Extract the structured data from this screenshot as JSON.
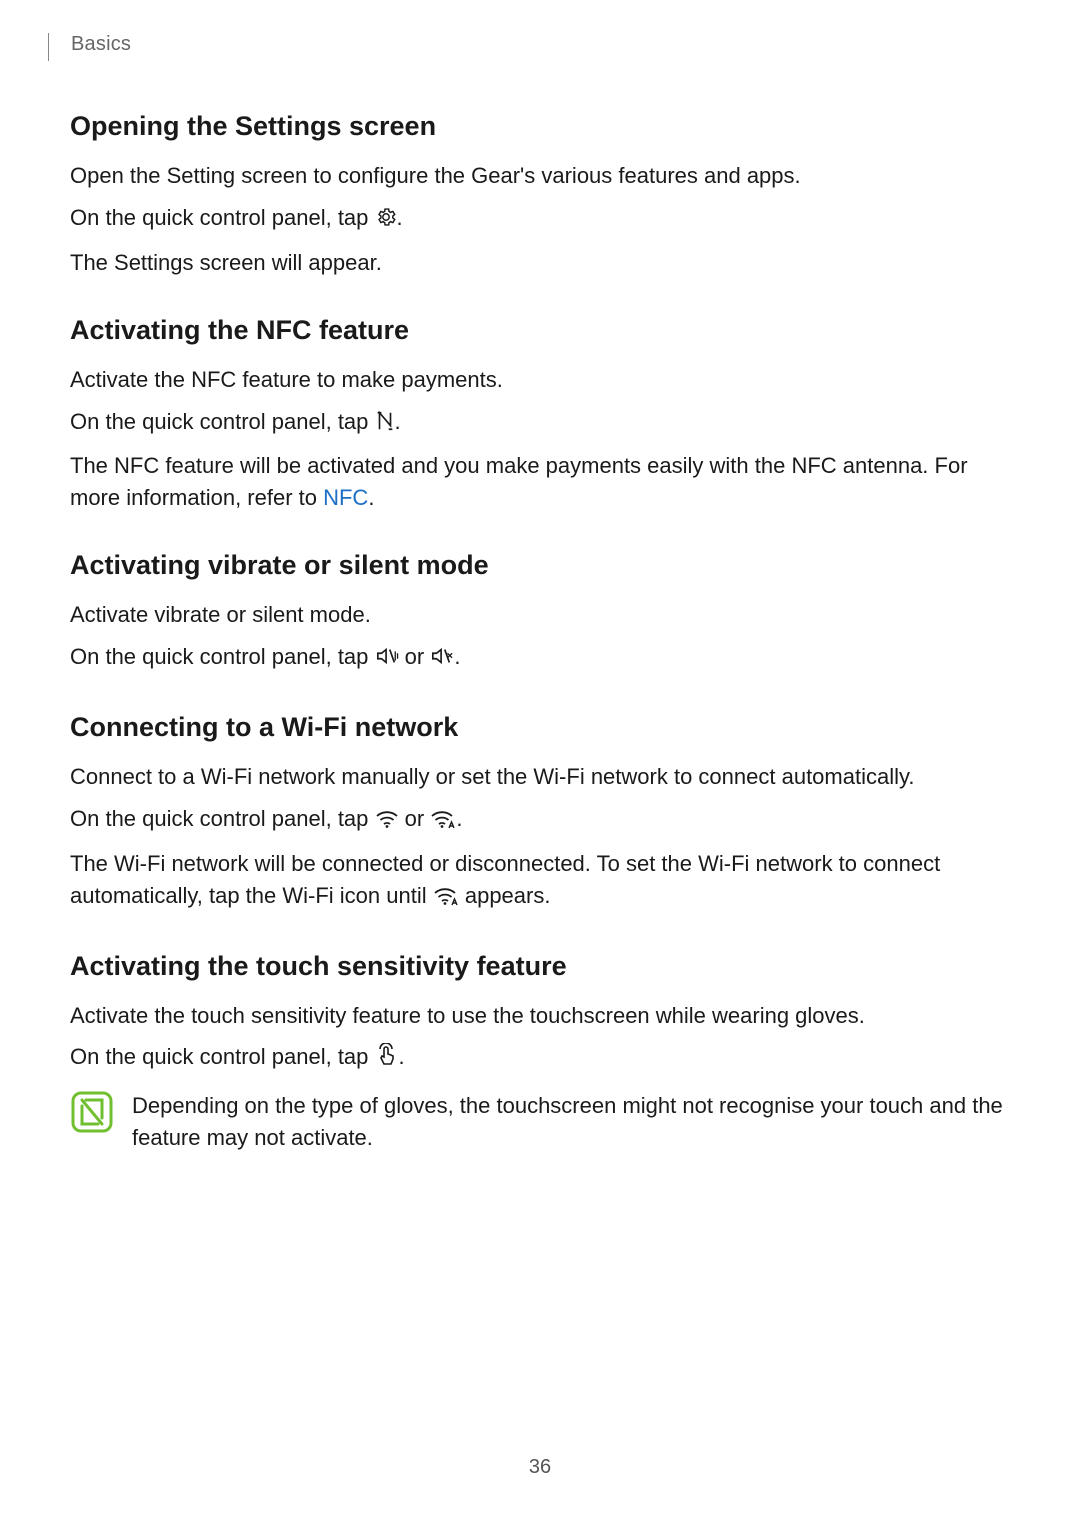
{
  "header": {
    "section": "Basics"
  },
  "sections": {
    "s1": {
      "heading": "Opening the Settings screen",
      "p1": "Open the Setting screen to configure the Gear's various features and apps.",
      "p2a": "On the quick control panel, tap ",
      "p2b": ".",
      "p3": "The Settings screen will appear."
    },
    "s2": {
      "heading": "Activating the NFC feature",
      "p1": "Activate the NFC feature to make payments.",
      "p2a": "On the quick control panel, tap ",
      "p2b": ".",
      "p3a": "The NFC feature will be activated and you make payments easily with the NFC antenna. For more information, refer to ",
      "p3link": "NFC",
      "p3b": "."
    },
    "s3": {
      "heading": "Activating vibrate or silent mode",
      "p1": "Activate vibrate or silent mode.",
      "p2a": "On the quick control panel, tap ",
      "p2mid": " or ",
      "p2b": "."
    },
    "s4": {
      "heading": "Connecting to a Wi-Fi network",
      "p1": "Connect to a Wi-Fi network manually or set the Wi-Fi network to connect automatically.",
      "p2a": "On the quick control panel, tap ",
      "p2mid": " or ",
      "p2b": ".",
      "p3a": "The Wi-Fi network will be connected or disconnected. To set the Wi-Fi network to connect automatically, tap the Wi-Fi icon until ",
      "p3b": " appears."
    },
    "s5": {
      "heading": "Activating the touch sensitivity feature",
      "p1": "Activate the touch sensitivity feature to use the touchscreen while wearing gloves.",
      "p2a": "On the quick control panel, tap ",
      "p2b": ".",
      "note": "Depending on the type of gloves, the touchscreen might not recognise your touch and the feature may not activate."
    }
  },
  "page_number": "36"
}
